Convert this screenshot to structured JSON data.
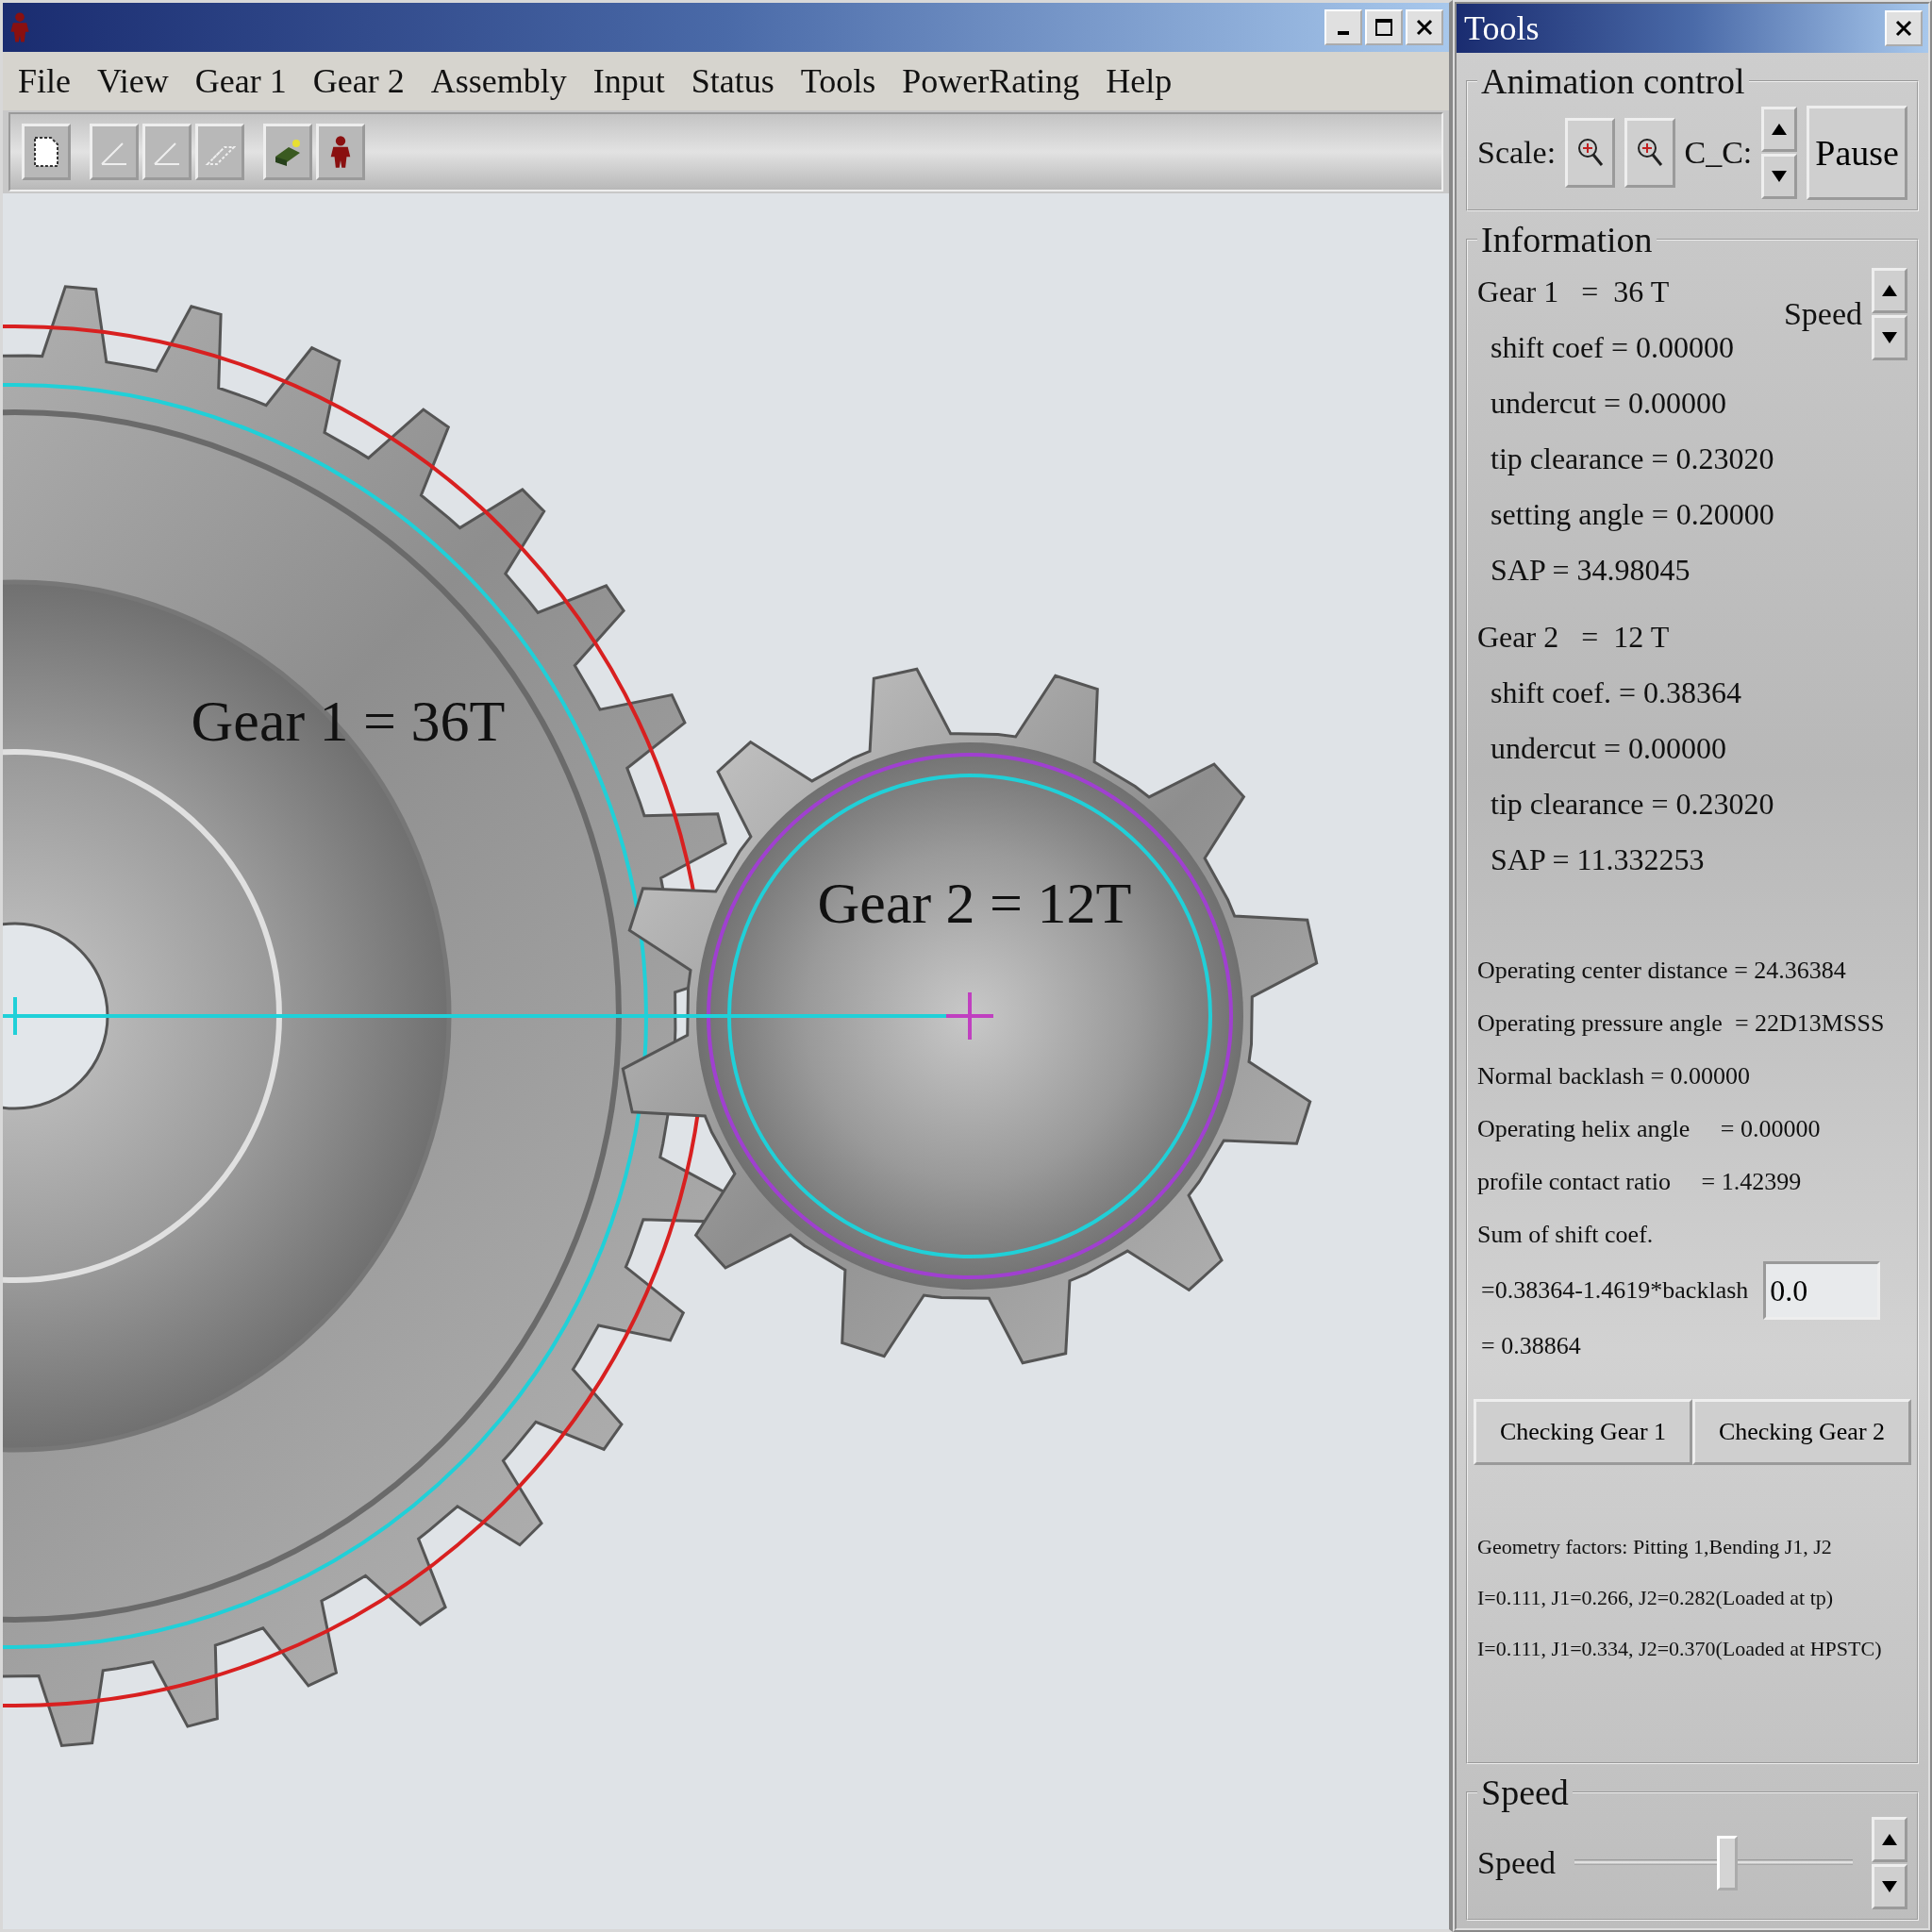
{
  "menu": [
    "File",
    "View",
    "Gear 1",
    "Gear 2",
    "Assembly",
    "Input",
    "Status",
    "Tools",
    "PowerRating",
    "Help"
  ],
  "canvas": {
    "gear_1_label": "Gear 1 = 36T",
    "gear_2_label": "Gear 2 = 12T"
  },
  "tools_panel": {
    "title": "Tools",
    "animation_control": {
      "title": "Animation control",
      "scale_label": "Scale:",
      "cc_label": "C_C:",
      "pause_button": "Pause"
    },
    "information": {
      "title": "Information",
      "gear_1": {
        "heading": "Gear 1   =  36 T",
        "lines": [
          "shift coef = 0.00000",
          "undercut = 0.00000",
          "tip clearance = 0.23020",
          "setting angle = 0.20000",
          "SAP = 34.98045"
        ]
      },
      "speed_label": "Speed",
      "gear_2": {
        "heading": "Gear 2   =  12 T",
        "lines": [
          "shift coef. = 0.38364",
          "undercut = 0.00000",
          "tip clearance = 0.23020",
          "SAP = 11.332253"
        ]
      },
      "operating_lines": [
        "Operating center distance = 24.36384",
        "Operating pressure angle  = 22D13MSSS",
        "Normal backlash = 0.00000",
        "Operating helix angle     = 0.00000",
        "profile contact ratio     = 1.42399",
        "Sum of shift coef."
      ],
      "backlash_formula": "=0.38364-1.4619*backlash",
      "backlash_field": {
        "value": "0.0"
      },
      "result": "= 0.38864",
      "buttons": [
        "Checking Gear 1",
        "Checking Gear 2"
      ],
      "geometry_lines": [
        "Geometry factors: Pitting 1,Bending J1, J2",
        "I=0.111, J1=0.266, J2=0.282(Loaded at tp)",
        "I=0.111, J1=0.334, J2=0.370(Loaded at HPSTC)"
      ]
    },
    "speed": {
      "title": "Speed",
      "label": "Speed",
      "level": 0.55
    }
  }
}
